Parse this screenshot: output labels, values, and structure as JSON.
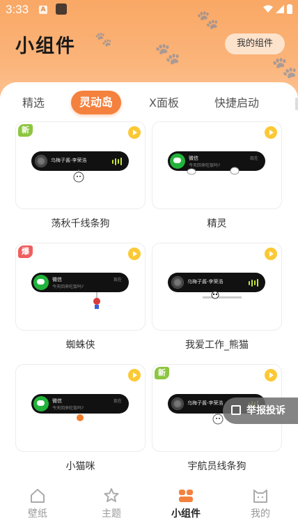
{
  "status_bar": {
    "time": "3:33",
    "a_icon_text": "A"
  },
  "header": {
    "title": "小组件",
    "my_widgets_label": "我的组件"
  },
  "tabs": [
    {
      "label": "精选",
      "active": false
    },
    {
      "label": "灵动岛",
      "active": true
    },
    {
      "label": "X面板",
      "active": false
    },
    {
      "label": "快捷启动",
      "active": false
    }
  ],
  "widgets": [
    {
      "name": "荡秋千线条狗",
      "badge": "新",
      "island_type": "music",
      "song": "乌梅子酱-李荣浩"
    },
    {
      "name": "精灵",
      "badge": "",
      "island_type": "wechat",
      "app": "微信",
      "message": "今天回来吃饭吗?",
      "time": "现在"
    },
    {
      "name": "蜘蛛侠",
      "badge": "爆",
      "island_type": "wechat",
      "app": "微信",
      "message": "今天回来吃饭吗?",
      "time": "现在"
    },
    {
      "name": "我爱工作_熊猫",
      "badge": "",
      "island_type": "music",
      "song": "乌梅子酱-李荣浩"
    },
    {
      "name": "小猫咪",
      "badge": "",
      "island_type": "wechat",
      "app": "微信",
      "message": "今天回来吃饭吗?",
      "time": "现在"
    },
    {
      "name": "宇航员线条狗",
      "badge": "新",
      "island_type": "music",
      "song": "乌梅子酱-李荣浩"
    }
  ],
  "report_button": {
    "label": "举报投诉"
  },
  "bottom_nav": [
    {
      "label": "壁纸",
      "icon": "home-icon",
      "active": false
    },
    {
      "label": "主题",
      "icon": "star-icon",
      "active": false
    },
    {
      "label": "小组件",
      "icon": "widgets-icon",
      "active": true
    },
    {
      "label": "我的",
      "icon": "cat-face-icon",
      "active": false
    }
  ],
  "colors": {
    "accent": "#f4813d",
    "header": "#fbb47a",
    "play": "#fbc936",
    "badge_new": "#8cc63f",
    "badge_hot": "#f05e5e",
    "wechat": "#22b33b"
  }
}
